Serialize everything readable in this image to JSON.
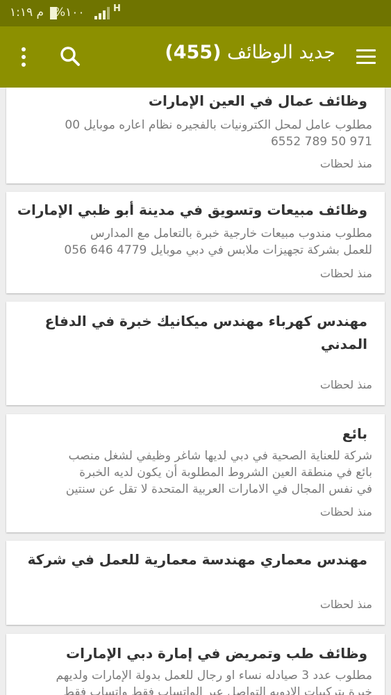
{
  "status_bar": {
    "time": "م ١:١٩",
    "battery": "%١٠٠",
    "network": "H",
    "icons": [
      "battery-icon",
      "signal-icon",
      "network-icon"
    ]
  },
  "app_bar": {
    "title": "جديد الوظائف",
    "count": "(455)",
    "icons": [
      "menu-icon",
      "search-icon",
      "more-options-icon"
    ],
    "color": "#8c9000",
    "status_color": "#6f7400"
  },
  "jobs": [
    {
      "title": "وظائف عمال في العين الإمارات",
      "desc": [
        "مطلوب عامل لمحل الكترونيات بالفجيره نظام اعاره موبايل 00",
        "971 50 789 6552"
      ],
      "time": "منذ لحظات"
    },
    {
      "title": "وظائف مبيعات وتسويق في مدينة أبو ظبي الإمارات",
      "desc": [
        "مطلوب مندوب مبيعات خارجية  خبرة بالتعامل مع المدارس",
        "للعمل بشركة تجهيزات ملابس في دبي موبايل 4779 646 056"
      ],
      "time": "منذ لحظات"
    },
    {
      "title_lines": [
        "مهندس كهرباء مهندس ميكانيك خبرة في الدفاع",
        "المدني"
      ],
      "desc": [],
      "time": "منذ لحظات"
    },
    {
      "title": "بائع",
      "desc": [
        "شركة للعناية الصحية في دبي لديها شاغر وظيفي لشغل منصب",
        "بائع في منطقة العين الشروط المطلوبة أن يكون لديه الخبرة",
        "في نفس المجال في الامارات العربية المتحدة لا تقل عن سنتين"
      ],
      "time": "منذ لحظات"
    },
    {
      "title": "مهندس معماري مهندسة معمارية للعمل في شركة",
      "desc": [],
      "time": "منذ لحظات"
    },
    {
      "title": "وظائف طب وتمريض في إمارة دبي الإمارات",
      "desc": [
        "مطلوب عدد 3 صيادله نساء او رجال للعمل بدولة الإمارات ولديهم",
        "خبرة بتركيبات الادويه التواصل عبر الواتساب فقط واتساب فقط"
      ],
      "time": ""
    }
  ]
}
